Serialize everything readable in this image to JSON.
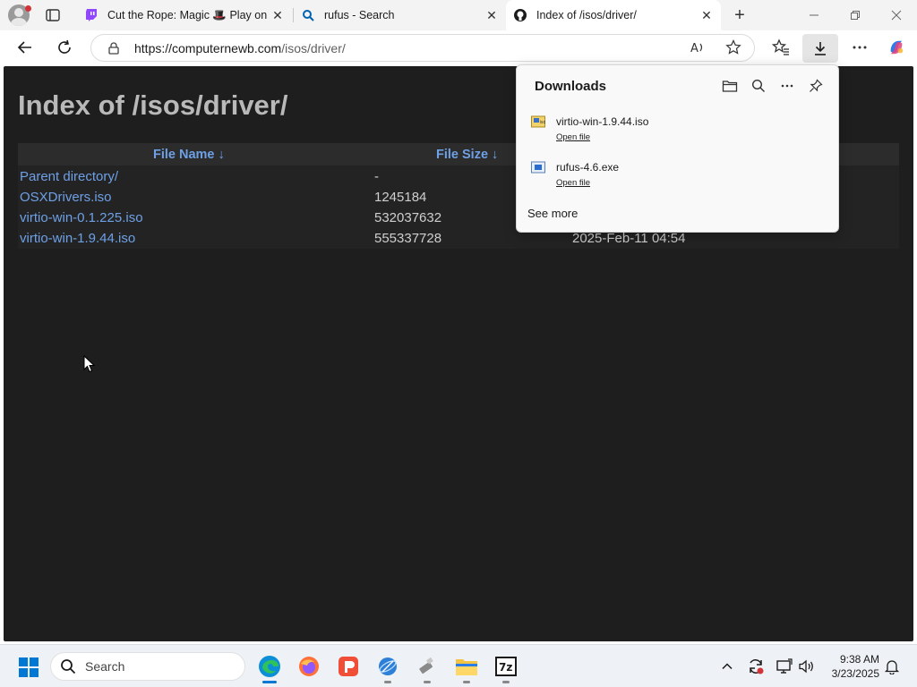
{
  "browser": {
    "tabs": [
      {
        "title": "Cut the Rope: Magic 🎩 Play on C",
        "favicon": "twitch-icon",
        "active": false
      },
      {
        "title": "rufus - Search",
        "favicon": "search-icon",
        "active": false
      },
      {
        "title": "Index of /isos/driver/",
        "favicon": "github-icon",
        "active": true
      }
    ],
    "url_host": "https://computernewb.com",
    "url_path": "/isos/driver/",
    "colors": {
      "accent": "#0078d4",
      "link": "#6ea0e6",
      "page_bg": "#1e1e1e"
    }
  },
  "page": {
    "heading": "Index of /isos/driver/",
    "columns": {
      "name": "File Name  ↓",
      "size": "File Size  ↓"
    },
    "rows": [
      {
        "name": "Parent directory/",
        "size": "-",
        "date": ""
      },
      {
        "name": "OSXDrivers.iso",
        "size": "1245184",
        "date": ""
      },
      {
        "name": "virtio-win-0.1.225.iso",
        "size": "532037632",
        "date": ""
      },
      {
        "name": "virtio-win-1.9.44.iso",
        "size": "555337728",
        "date": "2025-Feb-11 04:54"
      }
    ]
  },
  "downloads": {
    "title": "Downloads",
    "items": [
      {
        "file": "virtio-win-1.9.44.iso",
        "action": "Open file",
        "icon": "disc-image-icon"
      },
      {
        "file": "rufus-4.6.exe",
        "action": "Open file",
        "icon": "exe-icon"
      }
    ],
    "see_more": "See more"
  },
  "taskbar": {
    "search_placeholder": "Search",
    "time": "9:38 AM",
    "date": "3/23/2025"
  }
}
